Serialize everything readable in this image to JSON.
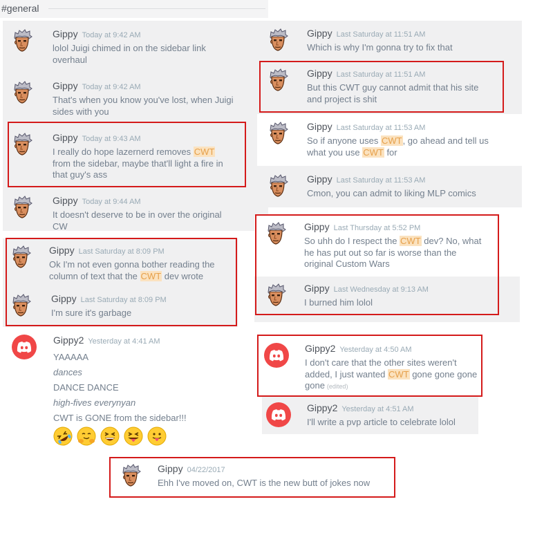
{
  "channel": {
    "name": "#general"
  },
  "left_messages": [
    {
      "author": "Gippy",
      "timestamp": "Today at 9:42 AM",
      "lines": [
        [
          {
            "t": "lolol Juigi chimed in on the sidebar link"
          }
        ],
        [
          {
            "t": "overhaul"
          }
        ]
      ]
    },
    {
      "author": "Gippy",
      "timestamp": "Today at 9:42 AM",
      "lines": [
        [
          {
            "t": "That's when you know you've lost, when Juigi"
          }
        ],
        [
          {
            "t": "sides with you"
          }
        ]
      ]
    },
    {
      "author": "Gippy",
      "timestamp": "Today at 9:43 AM",
      "lines": [
        [
          {
            "t": "I really do hope lazernerd removes "
          },
          {
            "t": "CWT",
            "hl": true
          }
        ],
        [
          {
            "t": "from the sidebar, maybe that'll light a fire in"
          }
        ],
        [
          {
            "t": "that guy's ass"
          }
        ]
      ]
    },
    {
      "author": "Gippy",
      "timestamp": "Today at 9:44 AM",
      "lines": [
        [
          {
            "t": "It doesn't deserve to be in over the original"
          }
        ],
        [
          {
            "t": "CW"
          }
        ]
      ]
    },
    {
      "author": "Gippy",
      "timestamp": "Last Saturday at 8:09 PM",
      "lines": [
        [
          {
            "t": "Ok I'm not even gonna bother reading the"
          }
        ],
        [
          {
            "t": "column of text that the "
          },
          {
            "t": "CWT",
            "hl": true
          },
          {
            "t": " dev wrote"
          }
        ]
      ]
    },
    {
      "author": "Gippy",
      "timestamp": "Last Saturday at 8:09 PM",
      "lines": [
        [
          {
            "t": "I'm sure it's garbage"
          }
        ]
      ]
    },
    {
      "author": "Gippy2",
      "timestamp": "Yesterday at 4:41 AM",
      "lines": [
        [
          {
            "t": "YAAAAA"
          }
        ],
        [
          {
            "t": "dances",
            "em": true
          }
        ],
        [
          {
            "t": "DANCE DANCE"
          }
        ],
        [
          {
            "t": "high-fives everynyan",
            "em": true
          }
        ],
        [
          {
            "t": "CWT is GONE from the sidebar!!!"
          }
        ]
      ]
    }
  ],
  "emojis": [
    {
      "name": "rolling-on-floor-laughing"
    },
    {
      "name": "hugging-face"
    },
    {
      "name": "grinning-squinting"
    },
    {
      "name": "squinting-tongue"
    },
    {
      "name": "face-with-tongue"
    }
  ],
  "right_messages": [
    {
      "author": "Gippy",
      "timestamp": "Last Saturday at 11:51 AM",
      "lines": [
        [
          {
            "t": "Which is why I'm gonna try to fix that"
          }
        ]
      ]
    },
    {
      "author": "Gippy",
      "timestamp": "Last Saturday at 11:51 AM",
      "lines": [
        [
          {
            "t": "But this CWT guy cannot admit that his site"
          }
        ],
        [
          {
            "t": "and project is shit"
          }
        ]
      ]
    },
    {
      "author": "Gippy",
      "timestamp": "Last Saturday at 11:53 AM",
      "lines": [
        [
          {
            "t": "So if anyone uses "
          },
          {
            "t": "CWT",
            "hl": true
          },
          {
            "t": ", go ahead and tell us"
          }
        ],
        [
          {
            "t": "what you use "
          },
          {
            "t": "CWT",
            "hl": true
          },
          {
            "t": " for"
          }
        ]
      ]
    },
    {
      "author": "Gippy",
      "timestamp": "Last Saturday at 11:53 AM",
      "lines": [
        [
          {
            "t": "Cmon, you can admit to liking MLP comics"
          }
        ]
      ]
    },
    {
      "author": "Gippy",
      "timestamp": "Last Thursday at 5:52 PM",
      "lines": [
        [
          {
            "t": "So uhh do I respect the "
          },
          {
            "t": "CWT",
            "hl": true
          },
          {
            "t": " dev? No, what"
          }
        ],
        [
          {
            "t": "he has put out so far is worse than the"
          }
        ],
        [
          {
            "t": "original Custom Wars"
          }
        ]
      ]
    },
    {
      "author": "Gippy",
      "timestamp": "Last Wednesday at 9:13 AM",
      "lines": [
        [
          {
            "t": "I burned him lolol"
          }
        ]
      ]
    },
    {
      "author": "Gippy2",
      "timestamp": "Yesterday at 4:50 AM",
      "lines": [
        [
          {
            "t": "I don't care that the other sites weren't"
          }
        ],
        [
          {
            "t": "added, I just wanted "
          },
          {
            "t": "CWT",
            "hl": true
          },
          {
            "t": " gone gone gone"
          }
        ],
        [
          {
            "t": "gone"
          },
          {
            "t": "(edited)",
            "edited": true
          }
        ]
      ]
    },
    {
      "author": "Gippy2",
      "timestamp": "Yesterday at 4:51 AM",
      "lines": [
        [
          {
            "t": "I'll write a pvp article to celebrate lolol"
          }
        ]
      ]
    }
  ],
  "bottom_message": {
    "author": "Gippy",
    "timestamp": "04/22/2017",
    "lines": [
      [
        {
          "t": "Ehh I've moved on, CWT is the new butt of jokes now"
        }
      ]
    ]
  },
  "colors": {
    "highlight_bg": "#fbe2bf",
    "highlight_text": "#e6a04b",
    "red_box": "#d41a1a",
    "discord_red": "#f04747"
  }
}
